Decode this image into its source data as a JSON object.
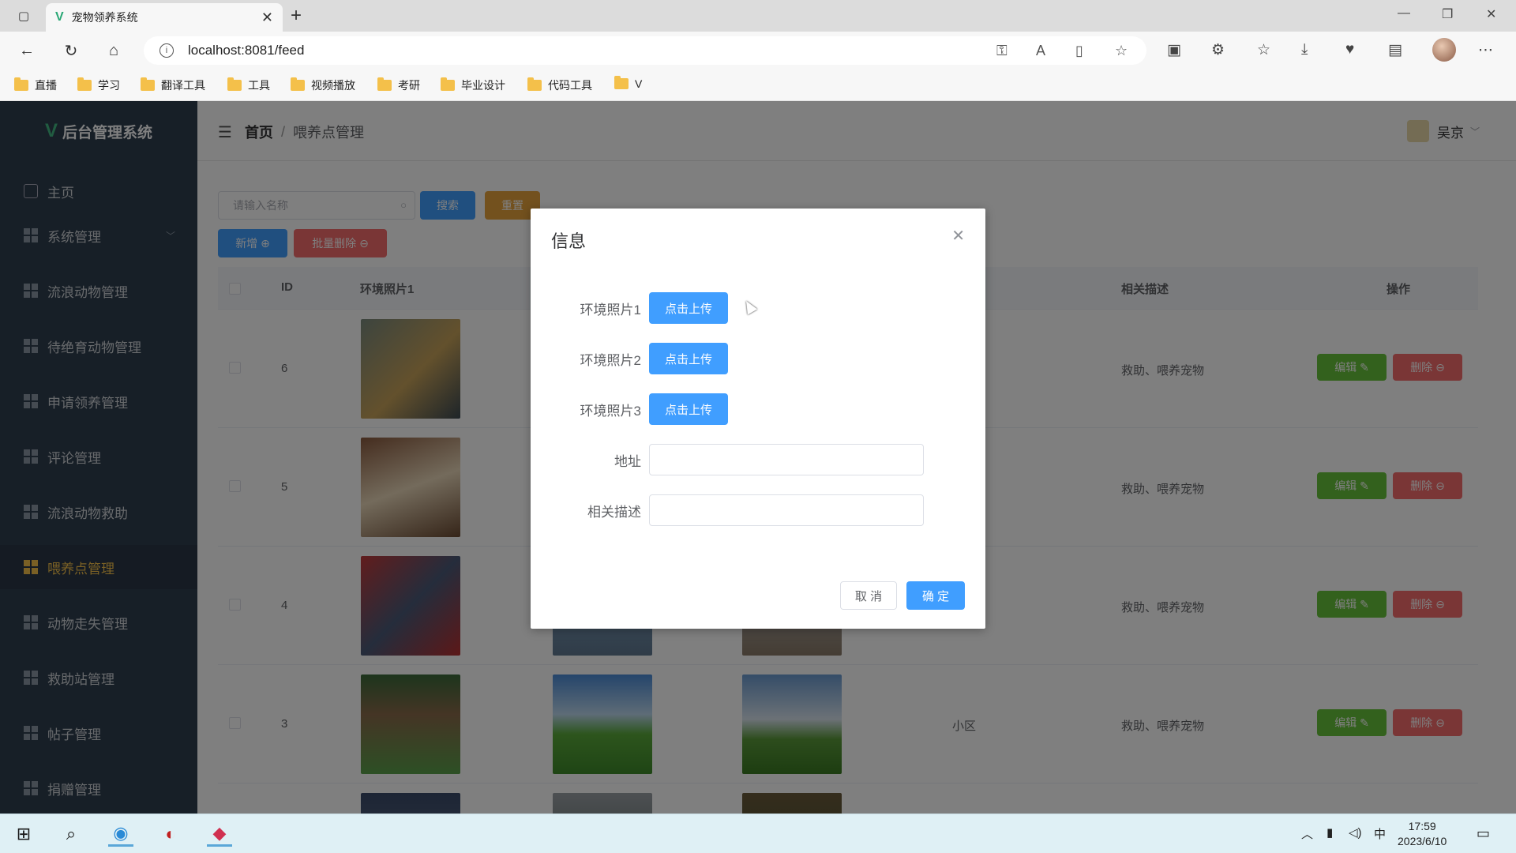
{
  "browser": {
    "tab_title": "宠物领养系统",
    "url": "localhost:8081/feed",
    "bookmarks": [
      "直播",
      "学习",
      "翻译工具",
      "工具",
      "视频播放",
      "考研",
      "毕业设计",
      "代码工具",
      "V"
    ]
  },
  "app": {
    "logo_text": "后台管理系统",
    "menu": [
      {
        "label": "主页"
      },
      {
        "label": "系统管理"
      },
      {
        "label": "流浪动物管理"
      },
      {
        "label": "待绝育动物管理"
      },
      {
        "label": "申请领养管理"
      },
      {
        "label": "评论管理"
      },
      {
        "label": "流浪动物救助"
      },
      {
        "label": "喂养点管理",
        "active": true
      },
      {
        "label": "动物走失管理"
      },
      {
        "label": "救助站管理"
      },
      {
        "label": "帖子管理"
      },
      {
        "label": "捐赠管理"
      }
    ],
    "breadcrumb": {
      "home": "首页",
      "current": "喂养点管理"
    },
    "user": "吴京"
  },
  "toolbar": {
    "search_placeholder": "请输入名称",
    "search_label": "搜索",
    "reset_label": "重置",
    "add_label": "新增 ⊕",
    "batch_delete_label": "批量删除 ⊖"
  },
  "table": {
    "headers": {
      "id": "ID",
      "photo1": "环境照片1",
      "desc": "相关描述",
      "ops": "操作"
    },
    "rows": [
      {
        "id": "6",
        "address": "",
        "desc": "救助、喂养宠物"
      },
      {
        "id": "5",
        "address": "",
        "desc": "救助、喂养宠物"
      },
      {
        "id": "4",
        "address": "",
        "desc": "救助、喂养宠物"
      },
      {
        "id": "3",
        "address": "小区",
        "desc": "救助、喂养宠物"
      }
    ],
    "edit_label": "编辑 ✎",
    "delete_label": "删除 ⊖"
  },
  "dialog": {
    "title": "信息",
    "fields": {
      "photo1": "环境照片1",
      "photo2": "环境照片2",
      "photo3": "环境照片3",
      "address": "地址",
      "desc": "相关描述"
    },
    "upload_label": "点击上传",
    "cancel_label": "取 消",
    "confirm_label": "确 定"
  },
  "taskbar": {
    "ime": "中",
    "time": "17:59",
    "date": "2023/6/10"
  },
  "colors": {
    "primary": "#409eff",
    "success": "#67c23a",
    "danger": "#f56c6c",
    "warning": "#e6a23c",
    "sidebar_bg": "#2f3e4f",
    "active_menu": "#f4c04a"
  }
}
